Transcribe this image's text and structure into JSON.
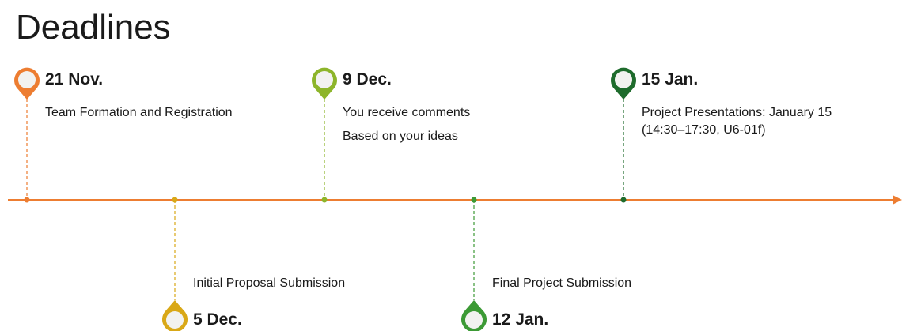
{
  "title": "Deadlines",
  "colors": {
    "axis": "#ED7D31",
    "orange": "#ED7D31",
    "gold": "#D9A817",
    "light_green": "#8DB52A",
    "medium_green": "#3C9A35",
    "dark_green": "#1E6B2C"
  },
  "events": [
    {
      "date": "21 Nov.",
      "lines": [
        "Team Formation and Registration"
      ],
      "color": "orange",
      "position": "above"
    },
    {
      "date": "5 Dec.",
      "lines": [
        "Initial Proposal Submission"
      ],
      "color": "gold",
      "position": "below"
    },
    {
      "date": "9 Dec.",
      "lines": [
        "You receive comments",
        "Based on your ideas"
      ],
      "color": "light_green",
      "position": "above"
    },
    {
      "date": "12 Jan.",
      "lines": [
        "Final Project Submission"
      ],
      "color": "medium_green",
      "position": "below"
    },
    {
      "date": "15 Jan.",
      "lines": [
        "Project Presentations: January 15",
        "(14:30–17:30, U6-01f)"
      ],
      "color": "dark_green",
      "position": "above"
    }
  ]
}
